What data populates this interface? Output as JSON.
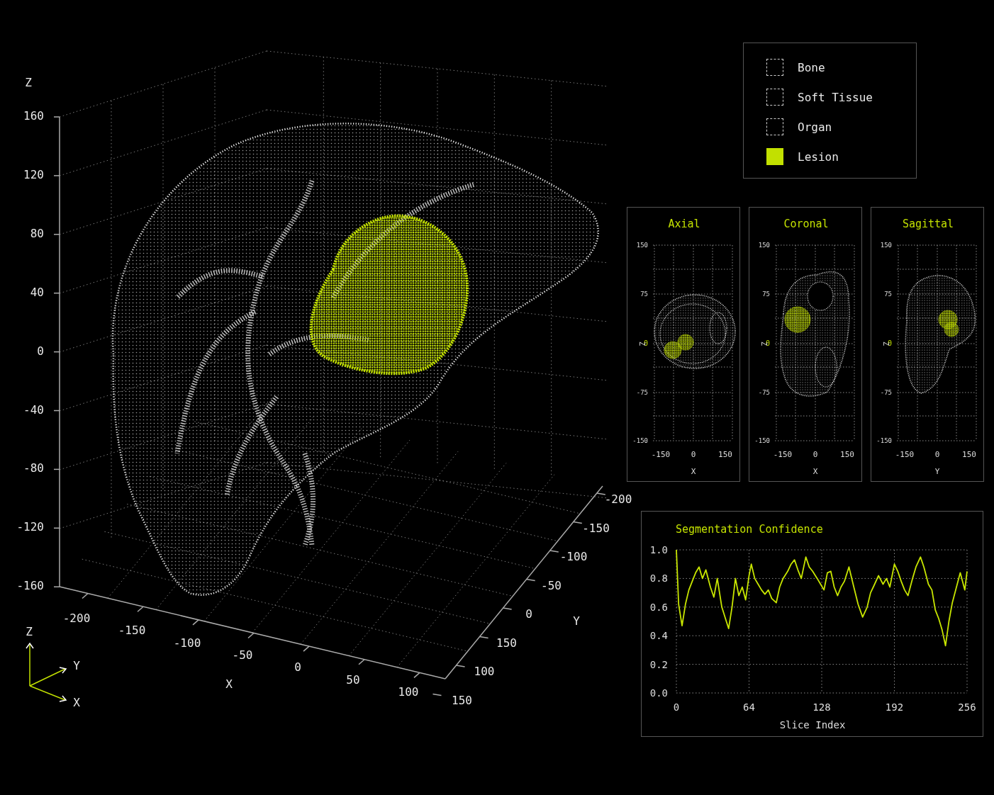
{
  "plot3d": {
    "z_axis": {
      "label": "Z",
      "ticks": [
        "160",
        "120",
        "80",
        "40",
        "0",
        "-40",
        "-80",
        "-120",
        "-160"
      ]
    },
    "x_axis": {
      "label": "X",
      "ticks": [
        "-200",
        "-150",
        "-100",
        "-50",
        "0",
        "50",
        "100"
      ]
    },
    "y_axis": {
      "label": "Y",
      "ticks": [
        "-200",
        "-150",
        "-100",
        "-50",
        "0",
        "150",
        "100",
        "150"
      ]
    }
  },
  "orientation_axes": [
    "Z",
    "Y",
    "X"
  ],
  "legend": {
    "items": [
      {
        "label": "Bone",
        "filled": false
      },
      {
        "label": "Soft Tissue",
        "filled": false
      },
      {
        "label": "Organ",
        "filled": false
      },
      {
        "label": "Lesion",
        "filled": true
      }
    ]
  },
  "slice_views": [
    {
      "title": "Axial",
      "kind": "axial",
      "y_axis_label": "Z",
      "y_ticks": [
        {
          "label": "150",
          "current": false
        },
        {
          "label": "75",
          "current": false
        },
        {
          "label": "0",
          "current": true
        },
        {
          "label": "-75",
          "current": false
        },
        {
          "label": "-150",
          "current": false
        }
      ],
      "x_ticks": [
        "-150",
        "0",
        "150"
      ],
      "x_axis_label": "X"
    },
    {
      "title": "Coronal",
      "kind": "coronal",
      "y_axis_label": "Z",
      "y_ticks": [
        {
          "label": "150",
          "current": false
        },
        {
          "label": "75",
          "current": false
        },
        {
          "label": "0",
          "current": true
        },
        {
          "label": "-75",
          "current": false
        },
        {
          "label": "-150",
          "current": false
        }
      ],
      "x_ticks": [
        "-150",
        "0",
        "150"
      ],
      "x_axis_label": "X"
    },
    {
      "title": "Sagittal",
      "kind": "sagittal",
      "y_axis_label": "Z",
      "y_ticks": [
        {
          "label": "150",
          "current": false
        },
        {
          "label": "75",
          "current": false
        },
        {
          "label": "0",
          "current": true
        },
        {
          "label": "-75",
          "current": false
        },
        {
          "label": "-150",
          "current": false
        }
      ],
      "x_ticks": [
        "-150",
        "0",
        "150"
      ],
      "x_axis_label": "Y"
    }
  ],
  "confidence": {
    "chart_data": {
      "type": "line",
      "title": "Segmentation Confidence",
      "xlabel": "Slice Index",
      "xlim": [
        0,
        256
      ],
      "ylim": [
        0,
        1
      ],
      "xticks": [
        0,
        64,
        128,
        192,
        256
      ],
      "yticks": [
        {
          "value": 0,
          "label": "0.0"
        },
        {
          "value": 0.2,
          "label": "0.2"
        },
        {
          "value": 0.4,
          "label": "0.4"
        },
        {
          "value": 0.6,
          "label": "0.6"
        },
        {
          "value": 0.8,
          "label": "0.8"
        },
        {
          "value": 1,
          "label": "1.0"
        }
      ],
      "x": [
        0,
        2,
        5,
        8,
        11,
        14,
        17,
        20,
        23,
        26,
        30,
        33,
        36,
        40,
        44,
        46,
        49,
        52,
        55,
        58,
        61,
        64,
        66,
        69,
        72,
        75,
        78,
        81,
        84,
        88,
        91,
        94,
        98,
        101,
        104,
        107,
        110,
        114,
        117,
        120,
        124,
        127,
        130,
        133,
        136,
        139,
        142,
        145,
        148,
        152,
        156,
        160,
        164,
        168,
        171,
        174,
        178,
        182,
        185,
        188,
        192,
        195,
        198,
        201,
        204,
        208,
        211,
        215,
        218,
        222,
        225,
        228,
        231,
        234,
        237,
        240,
        243,
        246,
        250,
        252,
        254,
        256
      ],
      "grid": true,
      "series": [
        {
          "color": "#c8e600",
          "values": [
            1.0,
            0.62,
            0.47,
            0.62,
            0.72,
            0.78,
            0.84,
            0.88,
            0.8,
            0.86,
            0.74,
            0.67,
            0.8,
            0.6,
            0.5,
            0.45,
            0.6,
            0.8,
            0.68,
            0.74,
            0.65,
            0.82,
            0.9,
            0.8,
            0.76,
            0.72,
            0.69,
            0.72,
            0.66,
            0.63,
            0.74,
            0.8,
            0.85,
            0.9,
            0.93,
            0.86,
            0.8,
            0.95,
            0.88,
            0.85,
            0.8,
            0.76,
            0.72,
            0.84,
            0.85,
            0.74,
            0.68,
            0.74,
            0.78,
            0.88,
            0.75,
            0.62,
            0.53,
            0.6,
            0.7,
            0.75,
            0.82,
            0.76,
            0.8,
            0.74,
            0.9,
            0.85,
            0.78,
            0.72,
            0.68,
            0.8,
            0.88,
            0.95,
            0.88,
            0.76,
            0.72,
            0.58,
            0.52,
            0.44,
            0.33,
            0.5,
            0.63,
            0.72,
            0.84,
            0.78,
            0.72,
            0.85
          ]
        }
      ]
    }
  }
}
